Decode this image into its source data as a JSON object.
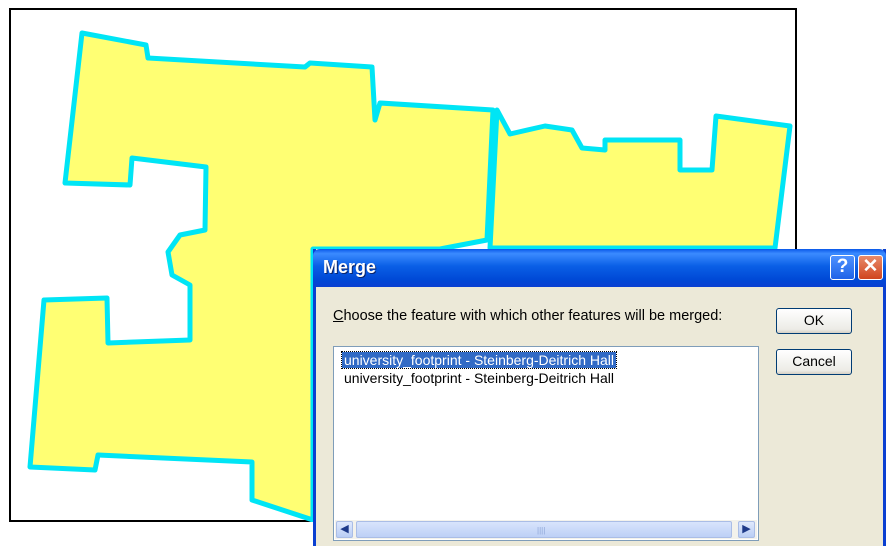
{
  "map": {
    "fill_color": "#ffff73",
    "outline_color": "#00e5f5",
    "features": [
      "university_footprint - Steinberg-Deitrich Hall",
      "university_footprint - Steinberg-Deitrich Hall"
    ]
  },
  "dialog": {
    "title": "Merge",
    "help_label": "?",
    "close_label": "✕",
    "prompt_first": "C",
    "prompt_rest": "hoose the feature with which other features will be merged:",
    "items": [
      {
        "label": "university_footprint - Steinberg-Deitrich Hall",
        "selected": true
      },
      {
        "label": "university_footprint - Steinberg-Deitrich Hall",
        "selected": false
      }
    ],
    "ok_label": "OK",
    "cancel_label": "Cancel",
    "scroll_left_icon": "◀",
    "scroll_right_icon": "▶",
    "scroll_grip": "||||"
  }
}
